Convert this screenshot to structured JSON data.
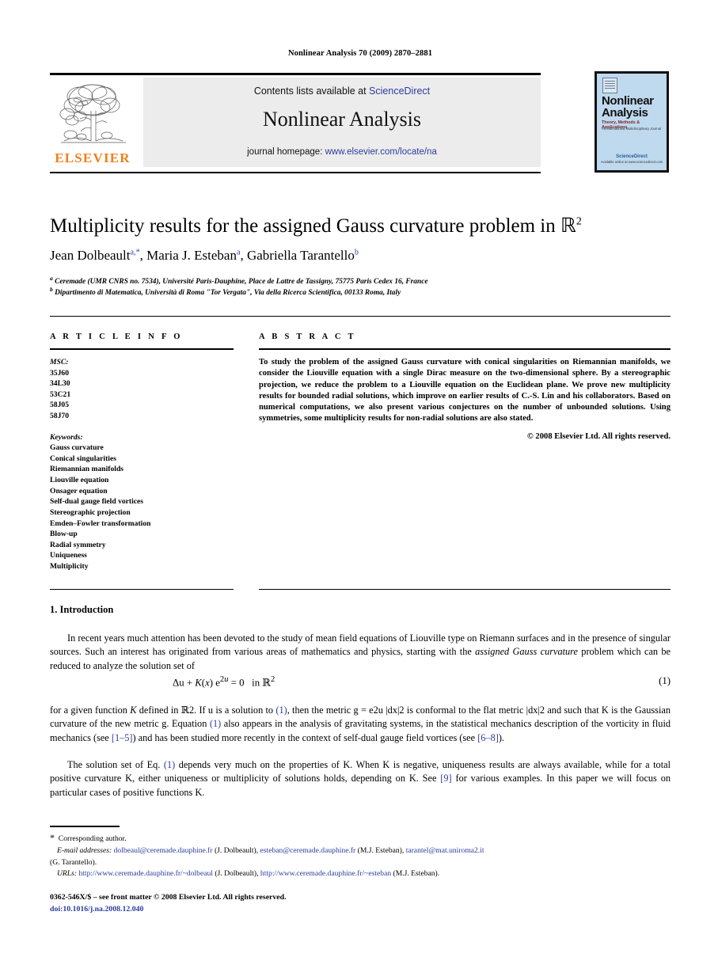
{
  "running_head": "Nonlinear Analysis 70 (2009) 2870–2881",
  "masthead": {
    "contents_prefix": "Contents lists available at ",
    "sciencedirect": "ScienceDirect",
    "journal_name": "Nonlinear Analysis",
    "homepage_prefix": "journal homepage: ",
    "homepage_url": "www.elsevier.com/locate/na",
    "publisher_wordmark": "ELSEVIER",
    "publisher_logo_icon": "elsevier-tree-icon"
  },
  "cover": {
    "line1": "Nonlinear",
    "line2": "Analysis",
    "subtitle": "Theory, Methods & Applications",
    "subtitle2": "An International Multidisciplinary Journal",
    "available_online": "ScienceDirect",
    "footer": "Available online at www.sciencedirect.com"
  },
  "article": {
    "title_main": "Multiplicity results for the assigned Gauss curvature problem in ",
    "title_symbol": "ℝ",
    "title_exponent": "2",
    "authors": [
      {
        "name": "Jean Dolbeault",
        "marks": "a,*"
      },
      {
        "name": "Maria J. Esteban",
        "marks": "a"
      },
      {
        "name": "Gabriella Tarantello",
        "marks": "b"
      }
    ],
    "affiliations": [
      {
        "mark": "a",
        "text": "Ceremade (UMR CNRS no. 7534), Université Paris-Dauphine, Place de Lattre de Tassigny, 75775 Paris Cedex 16, France"
      },
      {
        "mark": "b",
        "text": "Dipartimento di Matematica, Università di Roma \"Tor Vergata\", Via della Ricerca Scientifica, 00133 Roma, Italy"
      }
    ]
  },
  "info": {
    "heading": "A R T I C L E   I N F O",
    "msc_label": "MSC:",
    "msc_codes": [
      "35J60",
      "34L30",
      "53C21",
      "58J05",
      "58J70"
    ],
    "keywords_label": "Keywords:",
    "keywords": [
      "Gauss curvature",
      "Conical singularities",
      "Riemannian manifolds",
      "Liouville equation",
      "Onsager equation",
      "Self-dual gauge field vortices",
      "Stereographic projection",
      "Emden–Fowler transformation",
      "Blow-up",
      "Radial symmetry",
      "Uniqueness",
      "Multiplicity"
    ]
  },
  "abstract": {
    "heading": "A B S T R A C T",
    "body": "To study the problem of the assigned Gauss curvature with conical singularities on Riemannian manifolds, we consider the Liouville equation with a single Dirac measure on the two-dimensional sphere. By a stereographic projection, we reduce the problem to a Liouville equation on the Euclidean plane. We prove new multiplicity results for bounded radial solutions, which improve on earlier results of C.-S. Lin and his collaborators. Based on numerical computations, we also present various conjectures on the number of unbounded solutions. Using symmetries, some multiplicity results for non-radial solutions are also stated.",
    "copyright": "© 2008 Elsevier Ltd. All rights reserved."
  },
  "introduction": {
    "heading": "1. Introduction",
    "paragraph_1": "In recent years much attention has been devoted to the study of mean field equations of Liouville type on Riemann surfaces and in the presence of singular sources. Such an interest has originated from various areas of mathematics and physics, starting with the ",
    "paragraph_1_italic": "assigned Gauss curvature",
    "paragraph_1_tail": " problem which can be reduced to analyze the solution set of",
    "equation": "Δu + K(x) e2u = 0   in ℝ2",
    "equation_number": "(1)",
    "paragraph_2_a": "for a given function ",
    "paragraph_2_b": " defined in ℝ2. If u is a solution to ",
    "paragraph_2_cite1": "(1)",
    "paragraph_2_c": ", then the metric g = e2u |dx|2 is conformal to the flat metric |dx|2 and such that K is the Gaussian curvature of the new metric g. Equation ",
    "paragraph_2_cite2": "(1)",
    "paragraph_2_d": " also appears in the analysis of gravitating systems, in the statistical mechanics description of the vorticity in fluid mechanics (see ",
    "paragraph_2_cite3": "[1–5]",
    "paragraph_2_e": ") and has been studied more recently in the context of self-dual gauge field vortices (see ",
    "paragraph_2_cite4": "[6–8]",
    "paragraph_2_f": ").",
    "paragraph_3_a": "The solution set of Eq. ",
    "paragraph_3_cite1": "(1)",
    "paragraph_3_b": " depends very much on the properties of K. When K is negative, uniqueness results are always available, while for a total positive curvature K, either uniqueness or multiplicity of solutions holds, depending on K. See ",
    "paragraph_3_cite2": "[9]",
    "paragraph_3_c": " for various examples. In this paper we will focus on particular cases of positive functions K."
  },
  "footnotes": {
    "corresponding": "Corresponding author.",
    "email_label": "E-mail addresses:",
    "email_1": "dolbeaul@ceremade.dauphine.fr",
    "email_1_who": "(J. Dolbeault),",
    "email_2": "esteban@ceremade.dauphine.fr",
    "email_2_who": "(M.J. Esteban),",
    "email_3": "tarantel@mat.uniroma2.it",
    "email_3_who": "(G. Tarantello).",
    "urls_label": "URLs:",
    "url_1": "http://www.ceremade.dauphine.fr/~dolbeaul",
    "url_1_who": "(J. Dolbeault),",
    "url_2": "http://www.ceremade.dauphine.fr/~esteban",
    "url_2_who": "(M.J. Esteban).",
    "imprint": "0362-546X/$ – see front matter © 2008 Elsevier Ltd. All rights reserved.",
    "doi": "doi:10.1016/j.na.2008.12.040"
  },
  "colors": {
    "link": "#2b3c9e",
    "elsevier_orange": "#F07F1A",
    "band_gray": "#ececec",
    "cover_blue": "#bfd9ee"
  }
}
